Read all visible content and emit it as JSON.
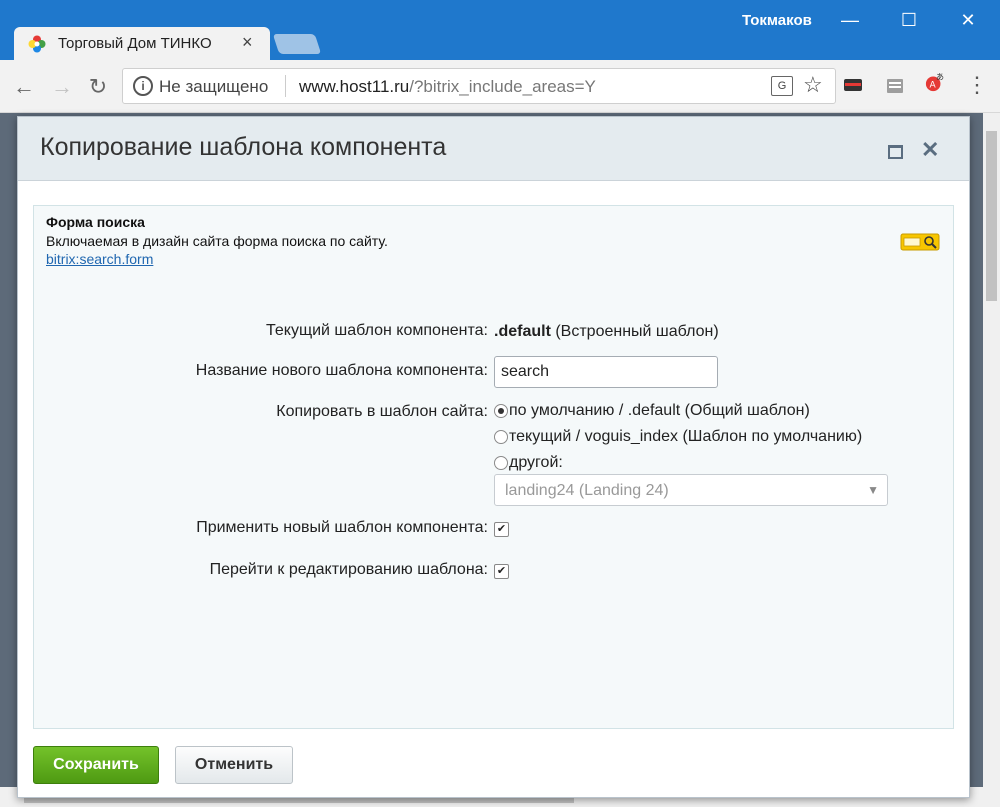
{
  "browser": {
    "user_name": "Токмаков",
    "tab_title": "Торговый Дом ТИНКО",
    "tab_close": "×",
    "security_label": "Не защищено",
    "url_host": "www.host11.ru",
    "url_rest": "/?bitrix_include_areas=Y",
    "window_minimize": "—",
    "window_maximize": "☐",
    "window_close": "✕"
  },
  "dialog": {
    "title": "Копирование шаблона компонента",
    "component": {
      "name": "Форма поиска",
      "description": "Включаемая в дизайн сайта форма поиска по сайту.",
      "code": "bitrix:search.form"
    },
    "form": {
      "current_template_label": "Текущий шаблон компонента:",
      "current_template_value": ".default",
      "current_template_note": "(Встроенный шаблон)",
      "new_template_label": "Название нового шаблона компонента:",
      "new_template_value": "search",
      "copy_to_label": "Копировать в шаблон сайта:",
      "copy_options": [
        {
          "label": "по умолчанию / .default (Общий шаблон)",
          "selected": true
        },
        {
          "label": "текущий / voguis_index (Шаблон по умолчанию)",
          "selected": false
        },
        {
          "label": "другой:",
          "selected": false
        }
      ],
      "other_template_select": "landing24 (Landing 24)",
      "apply_label": "Применить новый шаблон компонента:",
      "apply_checked": true,
      "edit_label": "Перейти к редактированию шаблона:",
      "edit_checked": true
    },
    "buttons": {
      "save": "Сохранить",
      "cancel": "Отменить"
    }
  },
  "colors": {
    "titlebar": "#1f78cc",
    "save_button": "#5eac1e",
    "link": "#2067b0"
  }
}
